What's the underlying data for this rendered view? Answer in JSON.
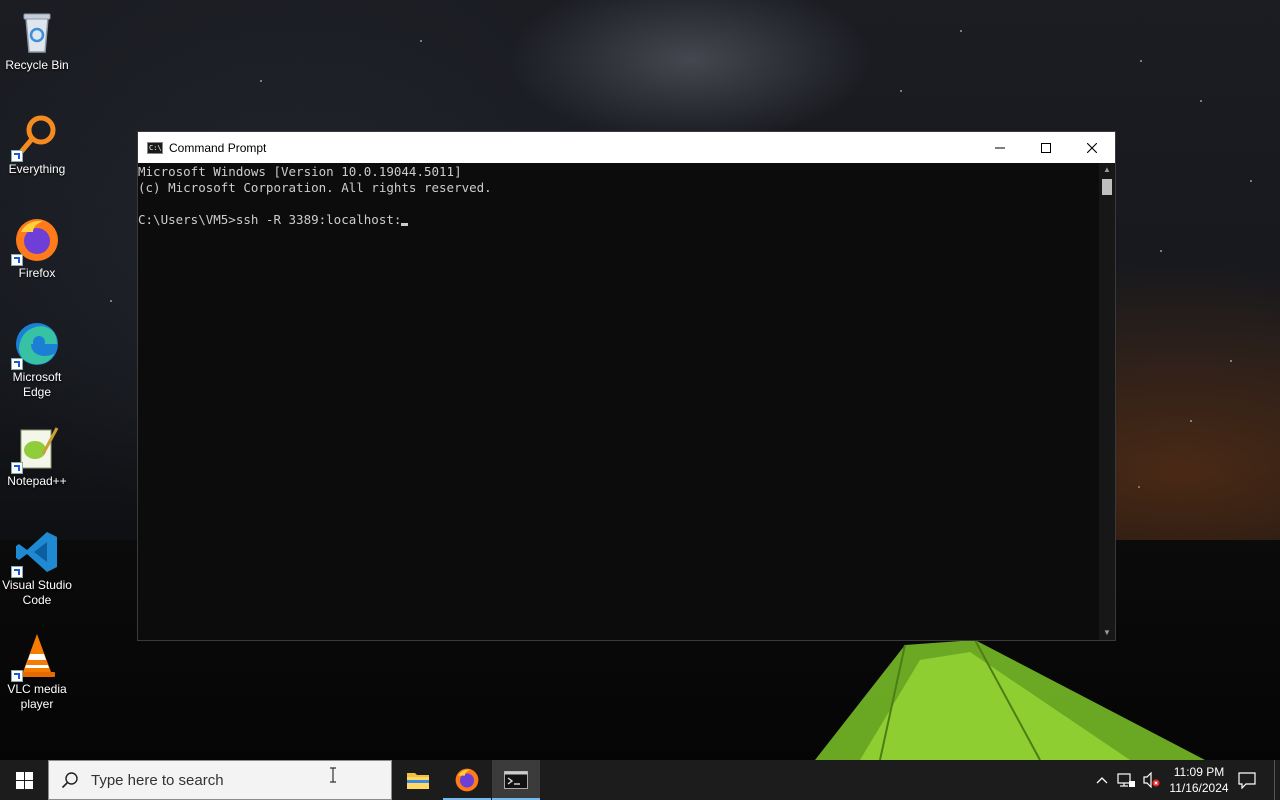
{
  "desktop": {
    "icons": [
      {
        "label": "Recycle Bin",
        "icon": "recycle-bin-icon"
      },
      {
        "label": "Everything",
        "icon": "everything-search-icon"
      },
      {
        "label": "Firefox",
        "icon": "firefox-icon"
      },
      {
        "label": "Microsoft Edge",
        "icon": "edge-icon"
      },
      {
        "label": "Notepad++",
        "icon": "notepad-plus-plus-icon"
      },
      {
        "label": "Visual Studio Code",
        "icon": "vscode-icon"
      },
      {
        "label": "VLC media player",
        "icon": "vlc-icon"
      }
    ]
  },
  "window": {
    "title": "Command Prompt",
    "controls": {
      "minimize": "minimize-icon",
      "maximize": "maximize-icon",
      "close": "close-icon"
    },
    "console_lines": [
      "Microsoft Windows [Version 10.0.19044.5011]",
      "(c) Microsoft Corporation. All rights reserved.",
      "",
      "C:\\Users\\VM5>ssh -R 3389:localhost:"
    ]
  },
  "taskbar": {
    "search_placeholder": "Type here to search",
    "apps": [
      {
        "name": "File Explorer",
        "icon": "file-explorer-icon"
      },
      {
        "name": "Firefox",
        "icon": "firefox-icon"
      },
      {
        "name": "Command Prompt",
        "icon": "cmd-icon",
        "active": true
      }
    ],
    "clock": {
      "time": "11:09 PM",
      "date": "11/16/2024"
    }
  },
  "colors": {
    "console_bg": "#0c0c0c",
    "console_text": "#cccccc",
    "taskbar_bg": "#1c1c1c",
    "active_indicator": "#76b9ed"
  }
}
